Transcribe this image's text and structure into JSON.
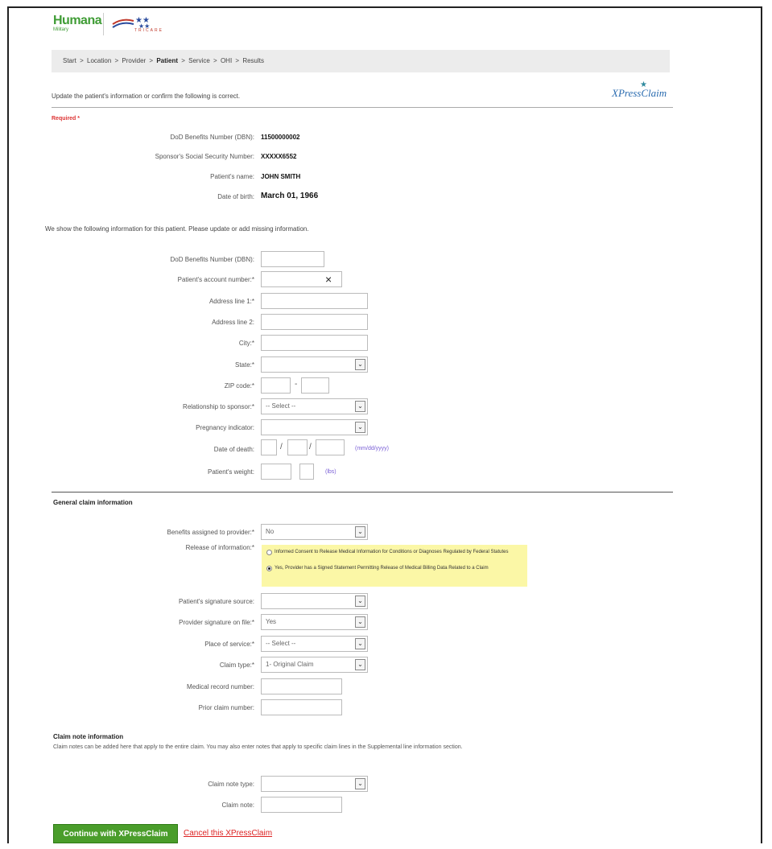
{
  "brand": {
    "humana": "Humana",
    "humana_sub": "Military",
    "tricare": "TRICARE",
    "xpress": "XPressClaim"
  },
  "breadcrumb": [
    "Start",
    ">",
    "Location",
    ">",
    "Provider",
    ">",
    "Patient",
    ">",
    "Service",
    ">",
    "OHI",
    ">",
    "Results"
  ],
  "breadcrumb_current": "Patient",
  "intro": "Update the patient's information or confirm the following is correct.",
  "required": "Required *",
  "patient": {
    "dbn_label": "DoD Benefits Number (DBN):",
    "dbn_value": "11500000002",
    "ssn_label": "Sponsor's Social Security Number:",
    "ssn_value": "XXXXX6552",
    "name_label": "Patient's name:",
    "name_value": "JOHN SMITH",
    "dob_label": "Date of birth:",
    "dob_value": "March 01, 1966"
  },
  "update_note": "We show the following information for this patient. Please update or add missing information.",
  "form": {
    "dbn": "DoD Benefits Number (DBN):",
    "account": "Patient's account number:*",
    "addr1": "Address line 1:*",
    "addr2": "Address line 2:",
    "city": "City:*",
    "state": "State:*",
    "zip": "ZIP code:*",
    "relationship": "Relationship to sponsor:*",
    "relationship_value": "-- Select --",
    "pregnancy": "Pregnancy indicator:",
    "death": "Date of death:",
    "date_hint": "(mm/dd/yyyy)",
    "weight": "Patient's weight:",
    "weight_hint": "(lbs)",
    "slash": "/",
    "dash": "-",
    "clear": "×"
  },
  "general": {
    "title": "General claim information",
    "benefits": "Benefits assigned to provider:*",
    "benefits_value": "No",
    "release": "Release of information:*",
    "release_opt1": "Informed Consent to Release Medical Information for Conditions or Diagnoses Regulated by Federal Statutes",
    "release_opt2": "Yes, Provider has a Signed Statement Permitting Release of Medical Billing Data Related to a Claim",
    "sig_source": "Patient's signature source:",
    "provider_sig": "Provider signature on file:*",
    "provider_sig_value": "Yes",
    "place": "Place of service:*",
    "place_value": "-- Select --",
    "claim_type": "Claim type:*",
    "claim_type_value": "1- Original Claim",
    "mrn": "Medical record number:",
    "prior": "Prior claim number:"
  },
  "claim_note": {
    "title": "Claim note information",
    "text": "Claim notes can be added here that apply to the entire claim. You may also enter notes that apply to specific claim lines in the Supplemental line information section.",
    "type": "Claim note type:",
    "note": "Claim note:"
  },
  "actions": {
    "continue": "Continue with XPressClaim",
    "cancel": "Cancel this XPressClaim"
  },
  "colors": {
    "brand_green": "#4a9d2b",
    "required_red": "#dd3333",
    "highlight_yellow": "#fbf7a6"
  }
}
